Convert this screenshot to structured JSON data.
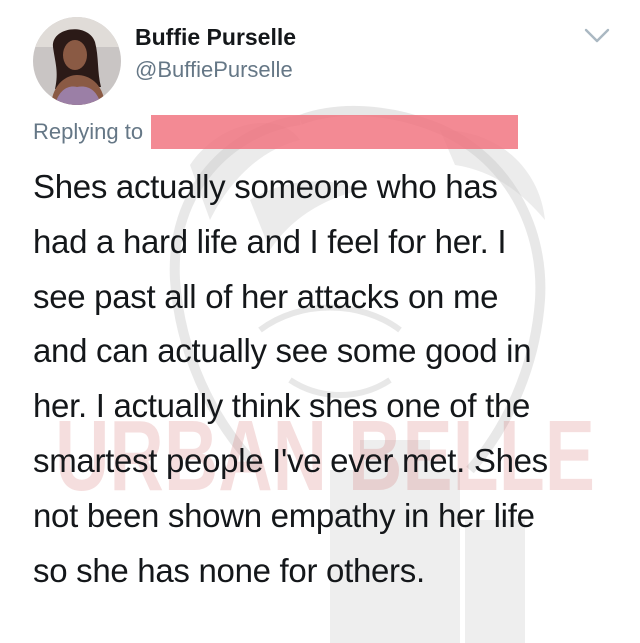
{
  "author": {
    "name": "Buffie Purselle",
    "handle": "@BuffiePurselle"
  },
  "reply": {
    "label": "Replying to"
  },
  "tweet": {
    "lines": [
      "Shes actually someone who has",
      "had a hard life and I feel for her. I",
      "see past all of her attacks on me",
      "and can actually see some good in",
      "her. I actually think shes one of the",
      "smartest people I've ever met. Shes",
      "not been shown empathy in her life",
      "so she has none for others."
    ]
  },
  "watermark": {
    "text": "URBAN BELLE"
  },
  "icons": {
    "menu": "chevron-down-icon",
    "avatar": "profile-photo"
  },
  "colors": {
    "text": "#14171a",
    "secondary": "#657786",
    "redaction": "#f0707c",
    "watermark_text": "#c43a3a"
  }
}
